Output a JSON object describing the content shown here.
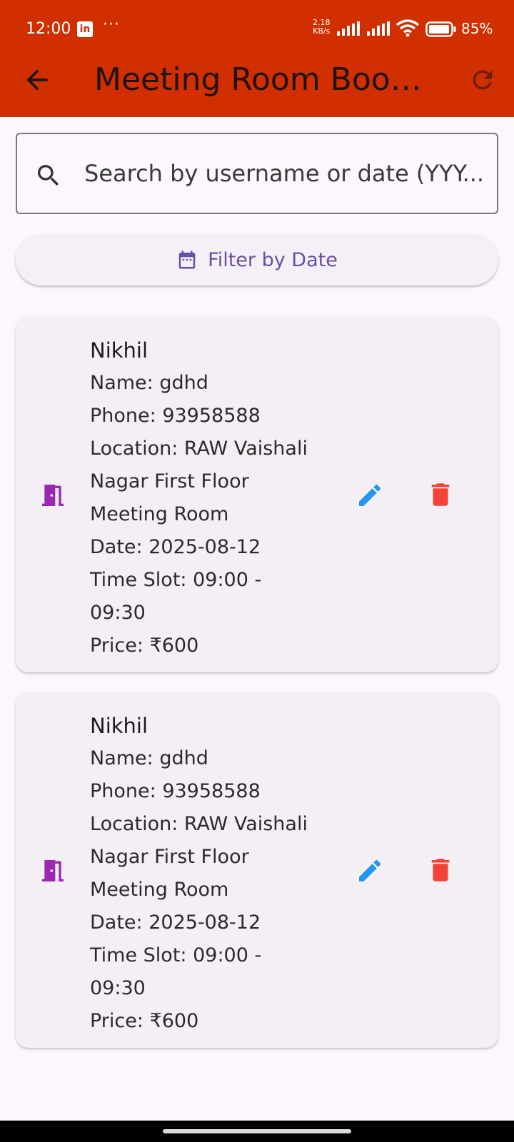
{
  "status_bar": {
    "time": "12:00",
    "notification_icon": "linkedin-icon",
    "overflow": "···",
    "speed_value": "2.18",
    "speed_unit": "KB/s",
    "battery": "85%"
  },
  "appbar": {
    "title": "Meeting Room Bookin...",
    "back_icon": "arrow-back-icon",
    "refresh_icon": "refresh-icon"
  },
  "search": {
    "placeholder": "Search by username or date (YYY..."
  },
  "filter": {
    "label": "Filter by Date"
  },
  "bookings": [
    {
      "username": "Nikhil",
      "name": "Name: gdhd",
      "phone": "Phone: 93958588",
      "location_1": "Location: RAW Vaishali",
      "location_2": "Nagar First Floor",
      "location_3": "Meeting Room",
      "date": "Date: 2025-08-12",
      "slot_1": "Time Slot: 09:00 -",
      "slot_2": "09:30",
      "price": "Price: ₹600"
    },
    {
      "username": "Nikhil",
      "name": "Name: gdhd",
      "phone": "Phone: 93958588",
      "location_1": "Location: RAW Vaishali",
      "location_2": "Nagar First Floor",
      "location_3": "Meeting Room",
      "date": "Date: 2025-08-12",
      "slot_1": "Time Slot: 09:00 -",
      "slot_2": "09:30",
      "price": "Price: ₹600"
    }
  ],
  "colors": {
    "appbar": "#d22f00",
    "accent": "#6750a4",
    "door_icon": "#9c27b0",
    "edit_icon": "#2196f3",
    "delete_icon": "#f44336"
  }
}
